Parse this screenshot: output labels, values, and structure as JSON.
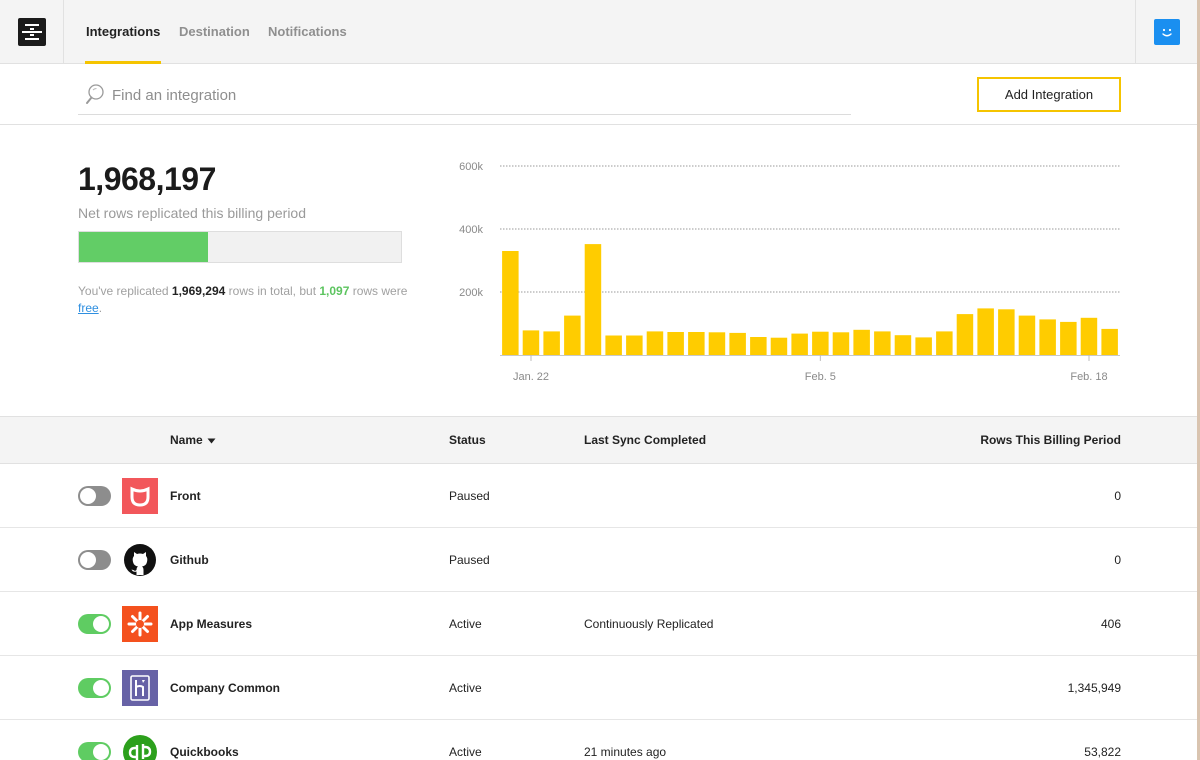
{
  "nav": {
    "tabs": [
      {
        "label": "Integrations",
        "active": true
      },
      {
        "label": "Destination",
        "active": false
      },
      {
        "label": "Notifications",
        "active": false
      }
    ],
    "logo_icon": "stitch-logo-icon",
    "user_icon": "smiley-avatar-icon"
  },
  "search": {
    "placeholder": "Find an integration",
    "value": ""
  },
  "add_button": {
    "label": "Add Integration"
  },
  "colors": {
    "accent": "#f5c400",
    "green": "#62cd66",
    "link": "#2f8fe0"
  },
  "stats": {
    "total": "1,968,197",
    "label": "Net rows replicated this billing period",
    "progress_fraction": 0.4,
    "note_prefix": "You've replicated ",
    "note_total": "1,969,294",
    "note_mid": " rows in total, but ",
    "note_free_count": "1,097",
    "note_rows": " rows were ",
    "note_free_link": "free",
    "note_end": "."
  },
  "chart_data": {
    "type": "bar",
    "y_ticks": [
      "600k",
      "400k",
      "200k"
    ],
    "y_tick_values": [
      600000,
      400000,
      200000
    ],
    "ylim": [
      0,
      600000
    ],
    "grid": true,
    "x_labels": [
      {
        "label": "Jan. 22",
        "index": 1
      },
      {
        "label": "Feb. 5",
        "index": 15
      },
      {
        "label": "Feb. 18",
        "index": 28
      }
    ],
    "values": [
      330000,
      78000,
      75000,
      125000,
      352000,
      62000,
      62000,
      75000,
      73000,
      73000,
      72000,
      70000,
      57000,
      55000,
      68000,
      74000,
      72000,
      80000,
      75000,
      63000,
      56000,
      75000,
      130000,
      148000,
      145000,
      125000,
      113000,
      105000,
      118000,
      83000
    ],
    "bar_color": "#ffcc00"
  },
  "table": {
    "columns": {
      "name": "Name",
      "status": "Status",
      "sync": "Last Sync Completed",
      "rows": "Rows This Billing Period"
    },
    "sort_icon": "caret-down-icon",
    "rows": [
      {
        "name": "Front",
        "status": "Paused",
        "sync": "",
        "rows": "0",
        "enabled": false,
        "icon": "front-logo-icon"
      },
      {
        "name": "Github",
        "status": "Paused",
        "sync": "",
        "rows": "0",
        "enabled": false,
        "icon": "github-logo-icon"
      },
      {
        "name": "App Measures",
        "status": "Active",
        "sync": "Continuously Replicated",
        "rows": "406",
        "enabled": true,
        "icon": "app-measures-logo-icon"
      },
      {
        "name": "Company Common",
        "status": "Active",
        "sync": "",
        "rows": "1,345,949",
        "enabled": true,
        "icon": "heroku-logo-icon"
      },
      {
        "name": "Quickbooks",
        "status": "Active",
        "sync": "21 minutes ago",
        "rows": "53,822",
        "enabled": true,
        "icon": "quickbooks-logo-icon"
      }
    ]
  }
}
